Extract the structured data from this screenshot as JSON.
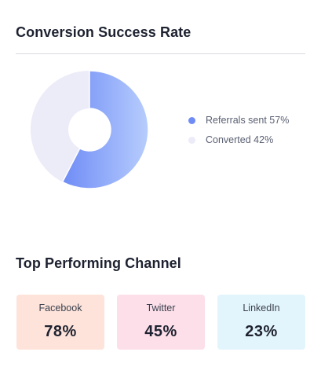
{
  "conversion": {
    "title": "Conversion Success Rate",
    "chart_data": {
      "type": "pie",
      "categories": [
        "Referrals sent",
        "Converted"
      ],
      "values": [
        57,
        42
      ],
      "colors": [
        "#8aa3fb",
        "#ecebf8"
      ]
    },
    "legend": [
      {
        "label": "Referrals sent",
        "value": "57%",
        "color": "#6f8cf6"
      },
      {
        "label": "Converted",
        "value": "42%",
        "color": "#ecebf8"
      }
    ]
  },
  "channels": {
    "title": "Top Performing Channel",
    "items": [
      {
        "name": "Facebook",
        "value": "78%",
        "bg": "#fde3da"
      },
      {
        "name": "Twitter",
        "value": "45%",
        "bg": "#fcdfe9"
      },
      {
        "name": "LinkedIn",
        "value": "23%",
        "bg": "#e3f5fc"
      }
    ]
  }
}
